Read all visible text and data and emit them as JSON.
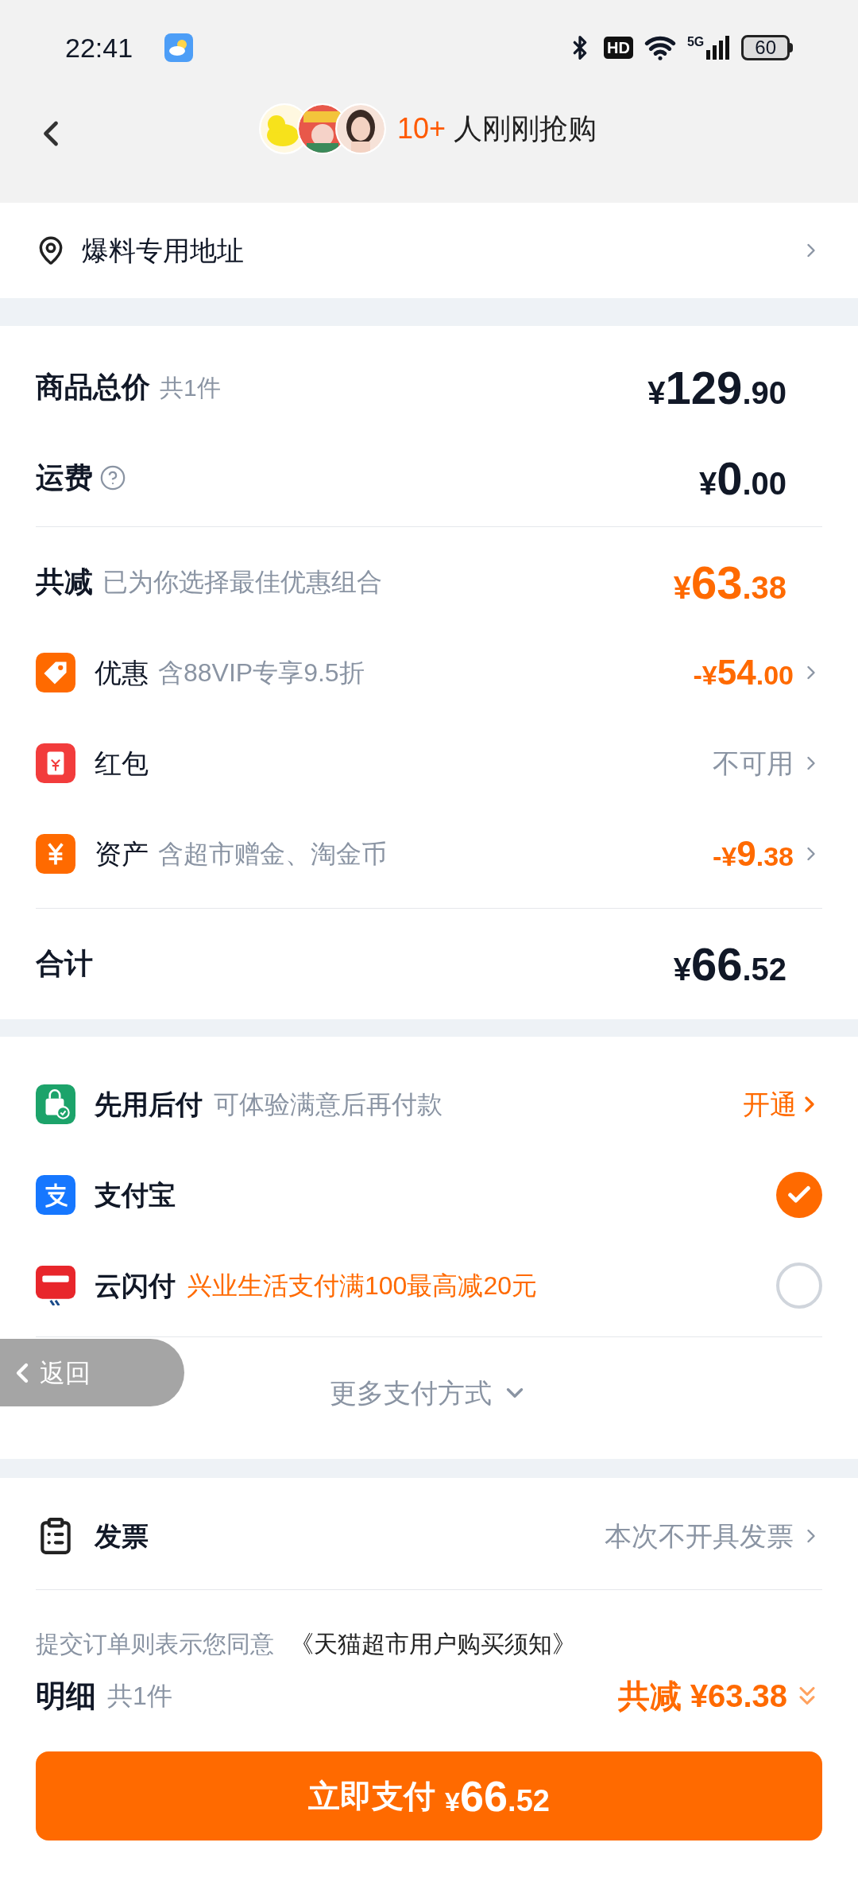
{
  "status_bar": {
    "time": "22:41",
    "hd": "HD",
    "network": "5G",
    "battery": "60"
  },
  "header": {
    "count": "10+",
    "text": "人刚刚抢购"
  },
  "address": {
    "label": "爆料专用地址"
  },
  "summary": {
    "subtotal": {
      "label": "商品总价",
      "note": "共1件",
      "price": {
        "currency": "¥",
        "integer": "129",
        "decimal": ".90"
      }
    },
    "shipping": {
      "label": "运费",
      "price": {
        "currency": "¥",
        "integer": "0",
        "decimal": ".00"
      }
    },
    "discount_total": {
      "label": "共减",
      "note": "已为你选择最佳优惠组合",
      "price": {
        "currency": "¥",
        "integer": "63",
        "decimal": ".38"
      }
    },
    "discounts": [
      {
        "label": "优惠",
        "note": "含88VIP专享9.5折",
        "kind": "amount",
        "value": {
          "currency": "-¥",
          "integer": "54",
          "decimal": ".00"
        }
      },
      {
        "label": "红包",
        "kind": "text",
        "text": "不可用"
      },
      {
        "label": "资产",
        "note": "含超市赠金、淘金币",
        "kind": "amount",
        "value": {
          "currency": "-¥",
          "integer": "9",
          "decimal": ".38"
        }
      }
    ],
    "total": {
      "label": "合计",
      "price": {
        "currency": "¥",
        "integer": "66",
        "decimal": ".52"
      }
    }
  },
  "payment_methods": [
    {
      "name": "先用后付",
      "note": "可体验满意后再付款",
      "promo": false,
      "kind": "activate",
      "action": "开通"
    },
    {
      "name": "支付宝",
      "kind": "radio",
      "selected": true
    },
    {
      "name": "云闪付",
      "note": "兴业生活支付满100最高减20元",
      "promo": true,
      "kind": "radio",
      "selected": false
    }
  ],
  "more_payment": "更多支付方式",
  "invoice": {
    "label": "发票",
    "value": "本次不开具发票"
  },
  "agreement": {
    "text": "提交订单则表示您同意",
    "link": "《天猫超市用户购买须知》"
  },
  "bottom_bar": {
    "label": "明细",
    "note": "共1件",
    "saving": "共减 ¥63.38",
    "pay_button": {
      "label": "立即支付",
      "price": {
        "currency": "¥",
        "integer": "66",
        "decimal": ".52"
      }
    }
  },
  "back_pill": "返回"
}
